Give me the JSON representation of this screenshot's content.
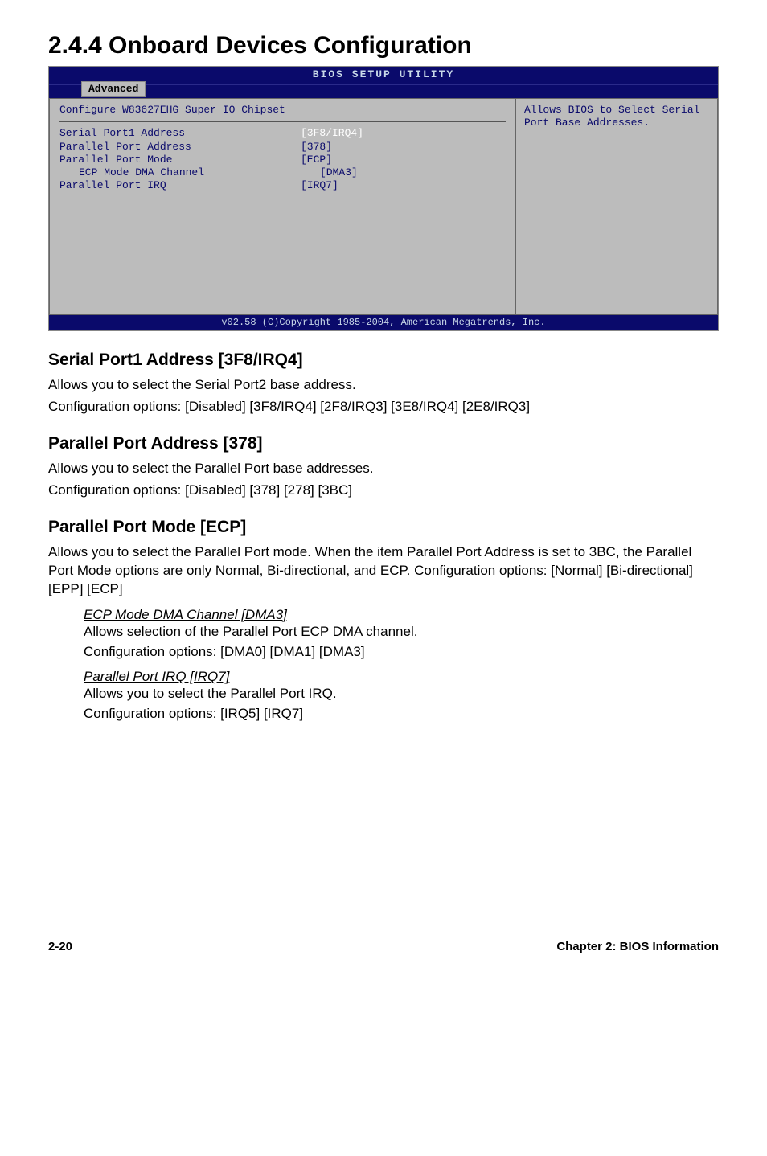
{
  "heading": "2.4.4  Onboard Devices Configuration",
  "bios": {
    "top_title": "BIOS SETUP UTILITY",
    "tab": "Advanced",
    "config_header": "Configure W83627EHG Super IO Chipset",
    "rows": [
      {
        "label": "Serial Port1 Address",
        "value": "[3F8/IRQ4]",
        "indent": false,
        "selected": true
      },
      {
        "label": "Parallel Port Address",
        "value": "[378]",
        "indent": false,
        "selected": false
      },
      {
        "label": "Parallel Port Mode",
        "value": "[ECP]",
        "indent": false,
        "selected": false
      },
      {
        "label": "ECP Mode DMA Channel",
        "value": "[DMA3]",
        "indent": true,
        "selected": false
      },
      {
        "label": "Parallel Port IRQ",
        "value": "[IRQ7]",
        "indent": false,
        "selected": false
      }
    ],
    "help": "Allows BIOS to Select Serial Port Base Addresses.",
    "footer": "v02.58 (C)Copyright 1985-2004, American Megatrends, Inc."
  },
  "sections": [
    {
      "title": "Serial Port1 Address [3F8/IRQ4]",
      "paras": [
        "Allows you to select the Serial Port2 base address.",
        "Configuration options: [Disabled] [3F8/IRQ4] [2F8/IRQ3] [3E8/IRQ4] [2E8/IRQ3]"
      ]
    },
    {
      "title": "Parallel Port Address [378]",
      "paras": [
        "Allows you to select the Parallel Port base addresses.",
        "Configuration options: [Disabled] [378] [278] [3BC]"
      ]
    },
    {
      "title": "Parallel Port Mode [ECP]",
      "paras": [
        "Allows you to select the Parallel Port mode. When the item Parallel Port Address is set to 3BC, the Parallel Port Mode options are only Normal, Bi-directional, and ECP. Configuration options: [Normal] [Bi-directional] [EPP] [ECP]"
      ],
      "subitems": [
        {
          "title": "ECP Mode DMA Channel [DMA3]",
          "paras": [
            "Allows selection of the Parallel Port ECP DMA channel.",
            "Configuration options: [DMA0] [DMA1] [DMA3]"
          ]
        },
        {
          "title": "Parallel Port IRQ [IRQ7]",
          "paras": [
            "Allows you to select the Parallel Port IRQ.",
            "Configuration options: [IRQ5] [IRQ7]"
          ]
        }
      ]
    }
  ],
  "footer": {
    "left": "2-20",
    "right": "Chapter 2: BIOS Information"
  }
}
